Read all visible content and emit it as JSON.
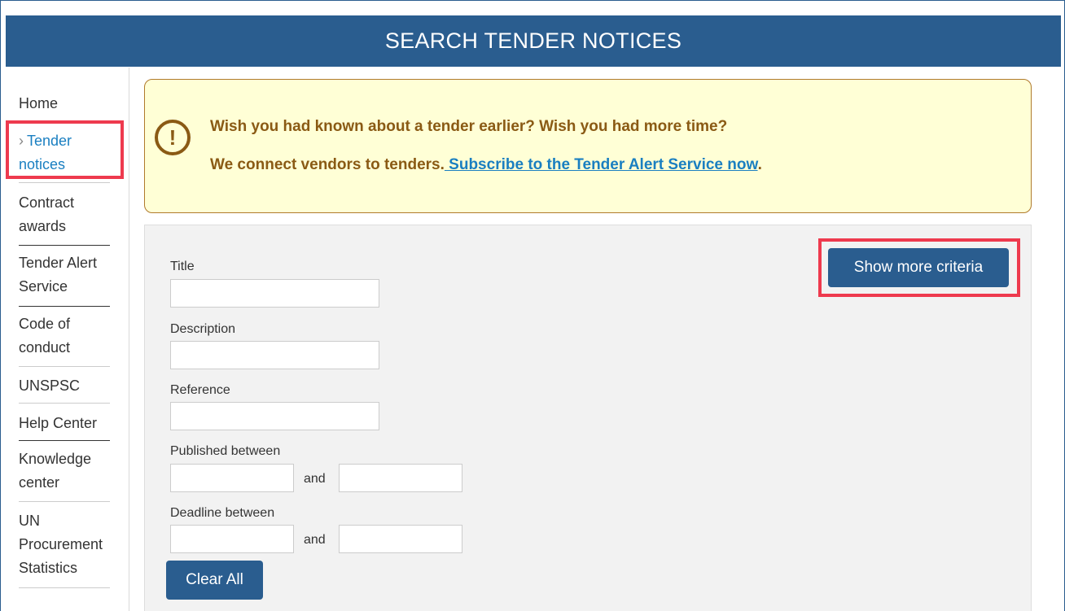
{
  "header": {
    "title": "SEARCH TENDER NOTICES"
  },
  "sidebar": {
    "items": [
      {
        "label_line1": "Home",
        "label_line2": ""
      },
      {
        "label_line1": "Tender",
        "label_line2": "notices",
        "active": true
      },
      {
        "label_line1": "Contract",
        "label_line2": "awards"
      },
      {
        "label_line1": "Tender Alert",
        "label_line2": "Service"
      },
      {
        "label_line1": "Code of",
        "label_line2": "conduct"
      },
      {
        "label_line1": "UNSPSC",
        "label_line2": ""
      },
      {
        "label_line1": "Help Center",
        "label_line2": ""
      },
      {
        "label_line1": "Knowledge",
        "label_line2": "center"
      },
      {
        "label_line1": "UN",
        "label_line2": "Procurement",
        "label_line3": "Statistics"
      }
    ]
  },
  "alert": {
    "line1": "Wish you had known about a tender earlier? Wish you had more time?",
    "line2_prefix": "We connect vendors to tenders.",
    "line2_link": " Subscribe to the Tender Alert Service now",
    "line2_suffix": "."
  },
  "search": {
    "show_more_label": "Show more criteria",
    "clear_all_label": "Clear All",
    "and_label": "and",
    "fields": {
      "title_label": "Title",
      "description_label": "Description",
      "reference_label": "Reference",
      "published_label": "Published between",
      "deadline_label": "Deadline between"
    }
  },
  "colors": {
    "header_bg": "#2a5d8f",
    "alert_bg": "#ffffd6",
    "alert_text": "#8a5a14",
    "link": "#1a7fc1",
    "highlight": "#ee3a4e"
  }
}
